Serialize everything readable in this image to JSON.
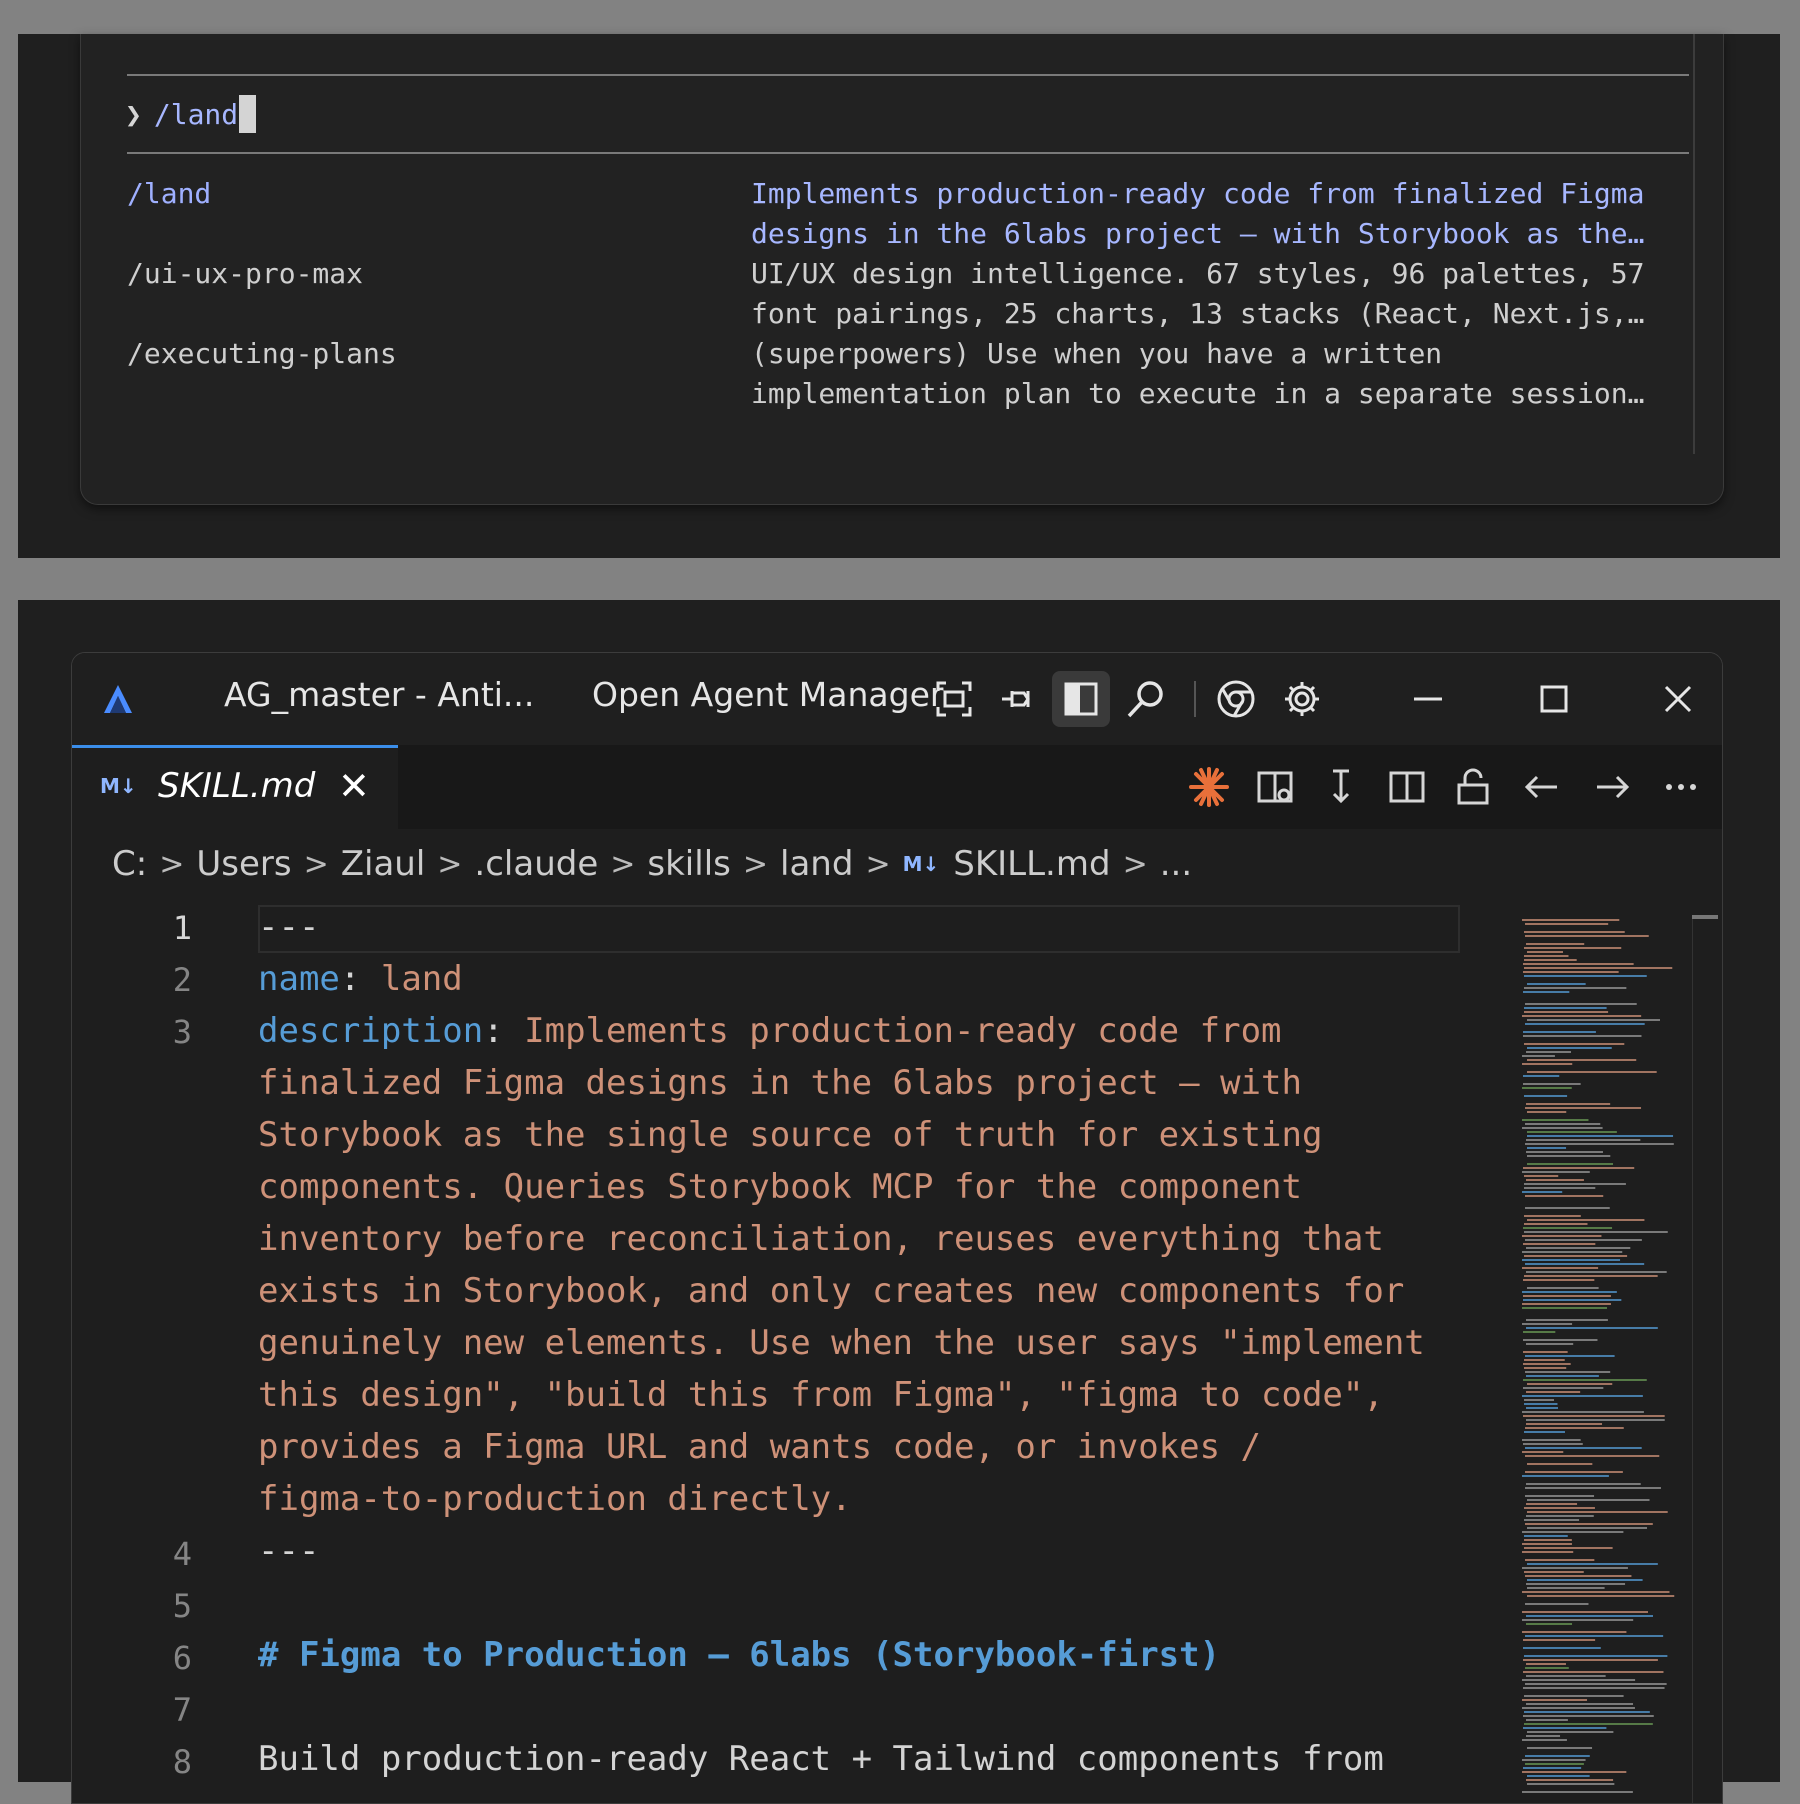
{
  "terminal": {
    "prompt_symbol": "❯",
    "input_value": "/land",
    "commands": [
      {
        "name": "/land",
        "desc": "Implements production-ready code from finalized Figma\ndesigns in the 6labs project — with Storybook as the…"
      },
      {
        "name": "/ui-ux-pro-max",
        "desc": "UI/UX design intelligence. 67 styles, 96 palettes, 57\nfont pairings, 25 charts, 13 stacks (React, Next.js,…"
      },
      {
        "name": "/executing-plans",
        "desc": "(superpowers) Use when you have a written\nimplementation plan to execute in a separate session…"
      }
    ]
  },
  "titlebar": {
    "window_title": "AG_master - Anti...",
    "agent_manager": "Open Agent Manager",
    "icons": [
      "app-logo-icon",
      "focus-frame-icon",
      "pin-icon",
      "layout-toggle-icon",
      "search-icon",
      "chrome-icon",
      "gear-icon",
      "minimize-icon",
      "maximize-icon",
      "close-icon"
    ]
  },
  "tab": {
    "badge": "M↓",
    "title": "SKILL.md",
    "close": "✕"
  },
  "editor_actions": [
    "claude-icon",
    "split-preview-icon",
    "arrow-down-to-line-icon",
    "split-editor-icon",
    "unlock-icon",
    "arrow-left-icon",
    "arrow-right-icon",
    "more-icon"
  ],
  "breadcrumb": {
    "parts": [
      "C:",
      "Users",
      "Ziaul",
      ".claude",
      "skills",
      "land"
    ],
    "file_badge": "M↓",
    "file": "SKILL.md",
    "tail": "..."
  },
  "code": {
    "line_numbers": [
      "1",
      "2",
      "3",
      "4",
      "5",
      "6",
      "7",
      "8"
    ],
    "line1": "---",
    "line2_key": "name",
    "line2_colon": ": ",
    "line2_val": "land",
    "line3_key": "description",
    "line3_colon": ": ",
    "line3_wrapped": [
      "Implements production-ready code from",
      "finalized Figma designs in the 6labs project — with",
      "Storybook as the single source of truth for existing",
      "components. Queries Storybook MCP for the component",
      "inventory before reconciliation, reuses everything that",
      "exists in Storybook, and only creates new components for",
      "genuinely new elements. Use when the user says \"implement",
      "this design\", \"build this from Figma\", \"figma to code\",",
      "provides a Figma URL and wants code, or invokes /",
      "figma-to-production directly."
    ],
    "line4": "---",
    "line6": "# Figma to Production — 6labs (Storybook-first)",
    "line8": "Build production-ready React + Tailwind components from"
  },
  "colors": {
    "accent": "#3b8eea",
    "keyword": "#569cd6",
    "string": "#ce9178",
    "selected_command": "#a7b7ff"
  }
}
